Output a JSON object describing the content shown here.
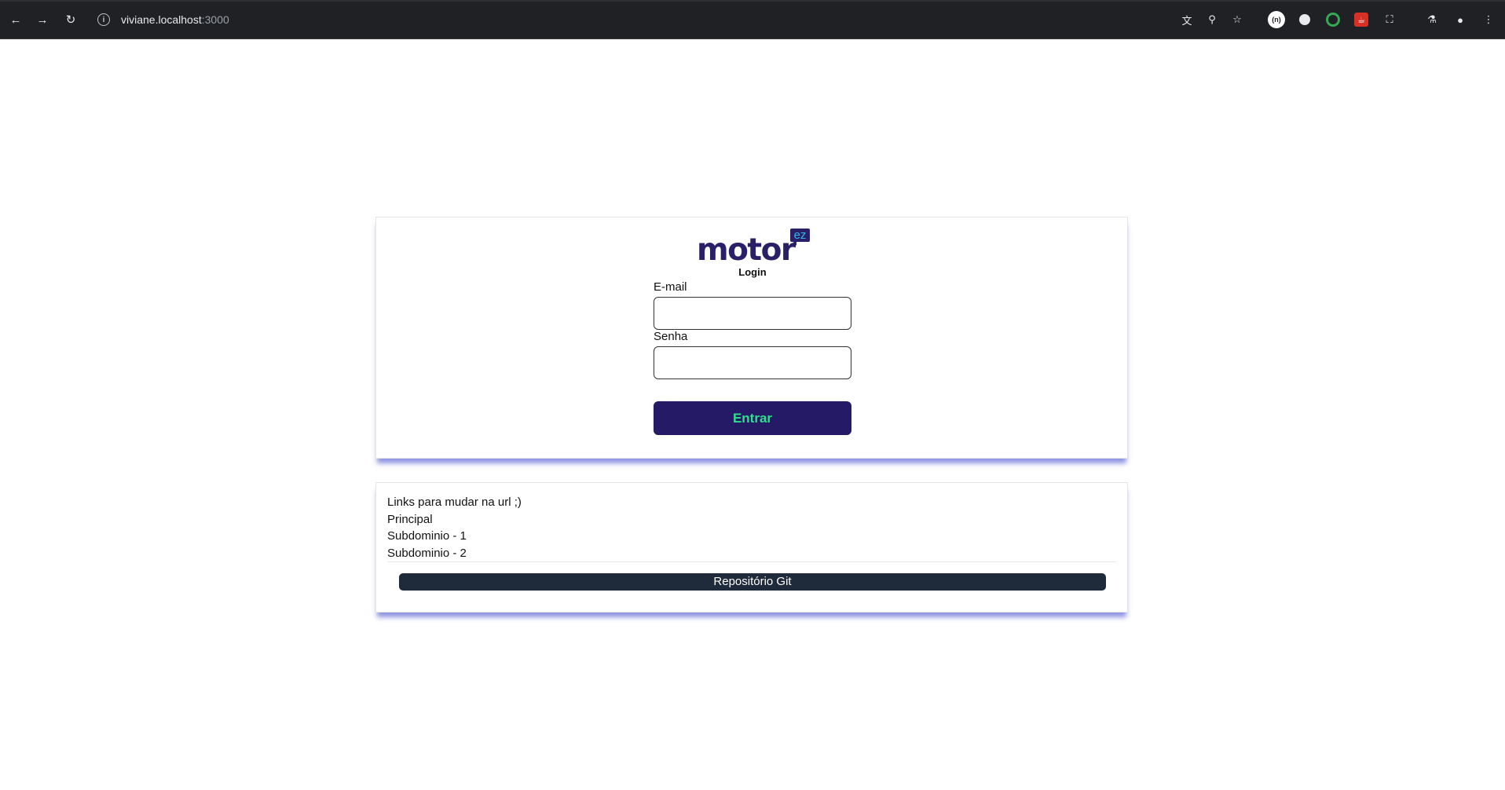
{
  "browser": {
    "url_host": "viviane.localhost",
    "url_port": ":3000",
    "extension_badge": "(n)"
  },
  "logo": {
    "word": "motor",
    "badge": "ez"
  },
  "login": {
    "title": "Login",
    "email_label": "E-mail",
    "email_value": "",
    "password_label": "Senha",
    "password_value": "",
    "submit_label": "Entrar"
  },
  "links": {
    "title": "Links para mudar na url ;)",
    "items": [
      "Principal",
      "Subdominio - 1",
      "Subdominio - 2"
    ],
    "git_button_label": "Repositório Git"
  },
  "colors": {
    "brand": "#241a66",
    "submit_text": "#2ee08a",
    "card_shadow": "#313cc8",
    "git_button": "#1f2a3a"
  }
}
